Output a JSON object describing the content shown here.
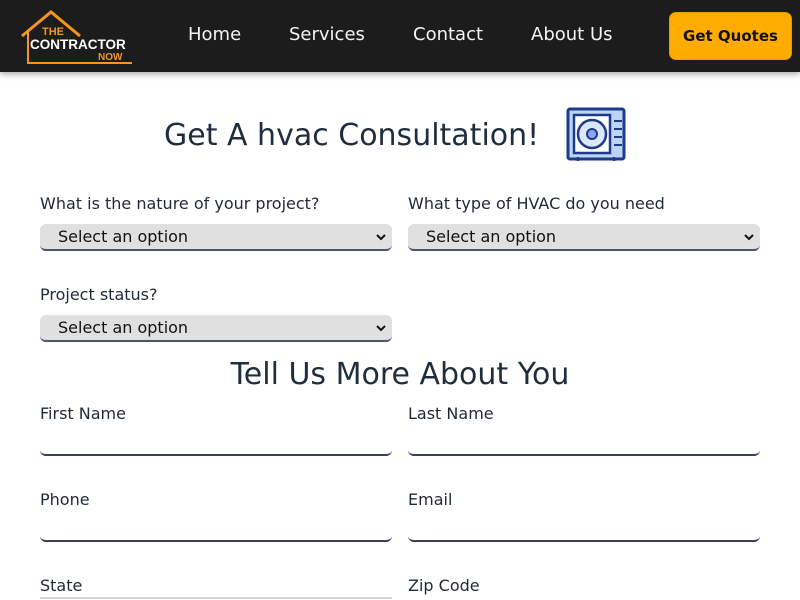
{
  "brand": {
    "line1": "THE",
    "line2": "CONTRACTOR",
    "line3": "NOW",
    "accent_color": "#f7941d"
  },
  "nav": {
    "links": [
      "Home",
      "Services",
      "Contact",
      "About Us"
    ],
    "cta_label": "Get Quotes",
    "cta_color": "#ffac00"
  },
  "page": {
    "title": "Get A hvac Consultation!",
    "icon": "hvac-unit-icon"
  },
  "project_form": {
    "nature_label": "What is the nature of your project?",
    "nature_value": "Select an option",
    "type_label": "What type of HVAC do you need",
    "type_value": "Select an option",
    "status_label": "Project status?",
    "status_value": "Select an option"
  },
  "about_you": {
    "title": "Tell Us More About You",
    "first_name_label": "First Name",
    "last_name_label": "Last Name",
    "phone_label": "Phone",
    "email_label": "Email",
    "state_label": "State",
    "zip_label": "Zip Code"
  }
}
